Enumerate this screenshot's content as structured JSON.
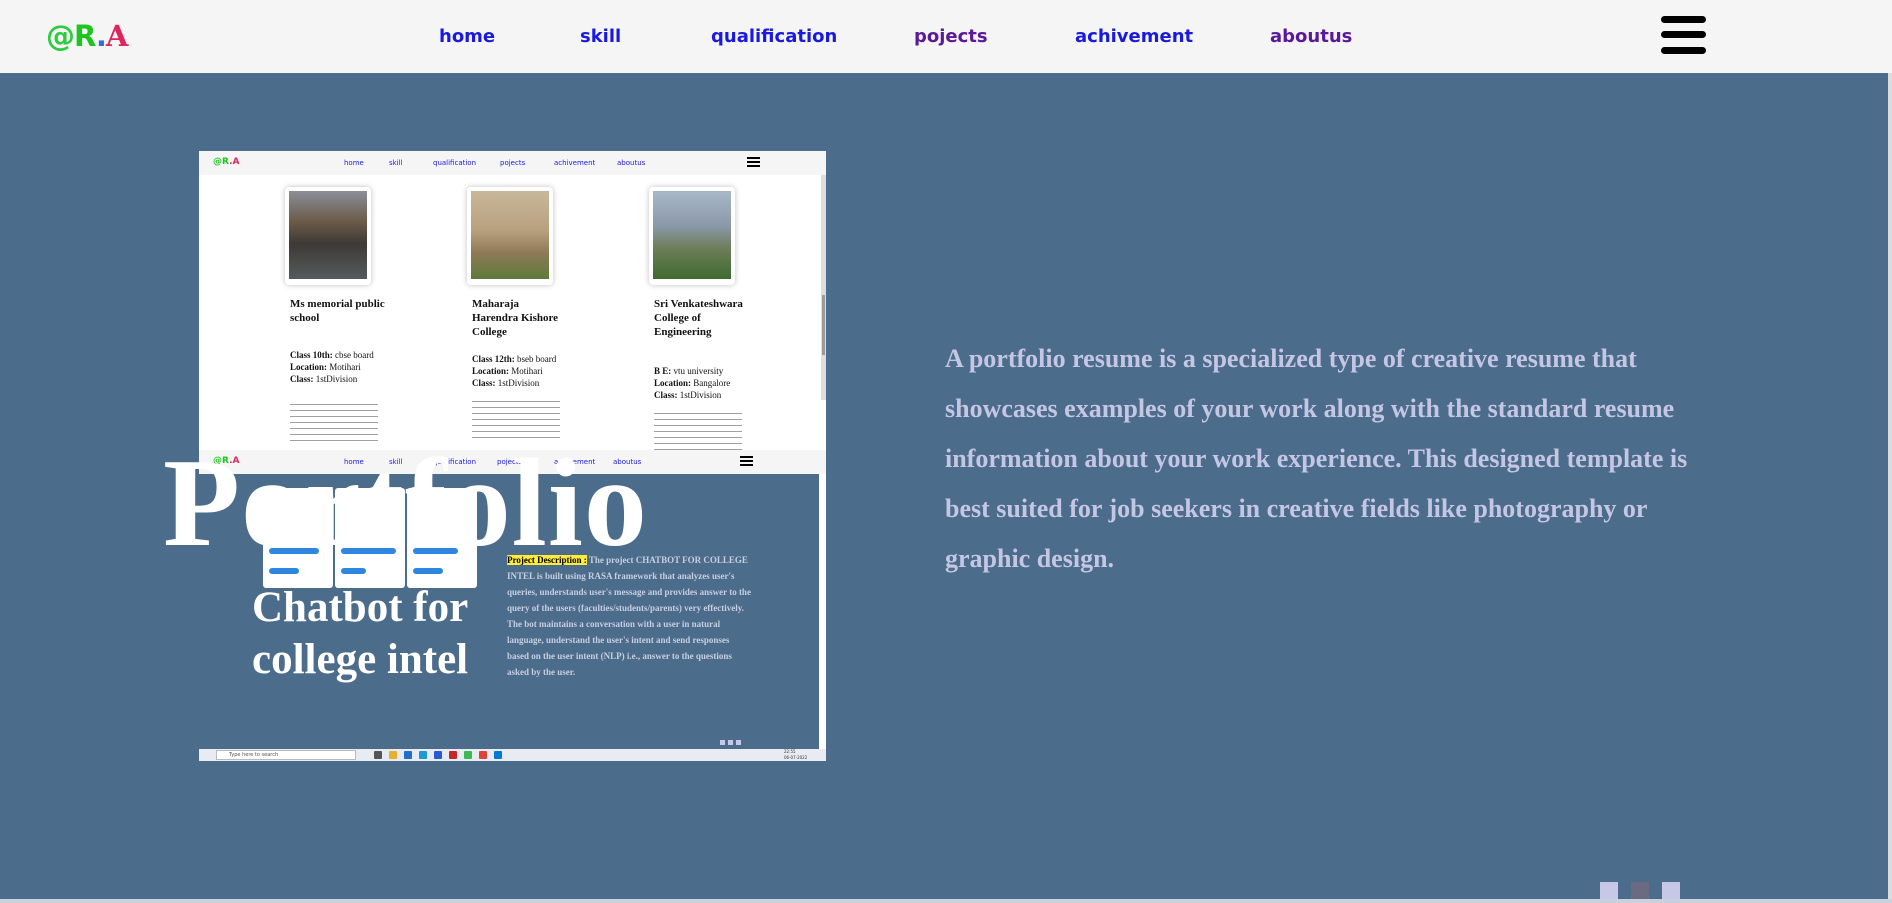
{
  "nav": {
    "logo": {
      "at": "@",
      "r": "R",
      "dot": ".",
      "a": "A"
    },
    "links": [
      "home",
      "skill",
      "qualification",
      "pojects",
      "achivement",
      "aboutus"
    ]
  },
  "screenshot": {
    "mini_logo": {
      "g": "@R",
      "rr": ".A"
    },
    "mini_links": [
      "home",
      "skill",
      "qualification",
      "pojects",
      "achivement",
      "aboutus"
    ],
    "schools": [
      {
        "name": "Ms memorial public school",
        "l1_label": "Class 10th:",
        "l1_value": " cbse board",
        "l2_label": "Location:",
        "l2_value": " Motihari",
        "l3_label": "Class:",
        "l3_value": " 1stDivision"
      },
      {
        "name": "Maharaja Harendra Kishore College",
        "l1_label": "Class 12th:",
        "l1_value": " bseb board",
        "l2_label": "Location:",
        "l2_value": " Motihari",
        "l3_label": "Class:",
        "l3_value": " 1stDivision"
      },
      {
        "name": "Sri Venkateshwara College of Engineering",
        "l1_label": "B E:",
        "l1_value": " vtu university",
        "l2_label": "Location:",
        "l2_value": " Bangalore",
        "l3_label": "Class:",
        "l3_value": " 1stDivision"
      }
    ],
    "project": {
      "label": "Project Description :",
      "text": "The project CHATBOT FOR COLLEGE INTEL is built using RASA framework that analyzes user's queries, understands user's message and provides answer to the query of the users (faculties/students/parents) very effectively. The bot maintains a conversation with a user in natural language, understand the user's intent and send responses based on the user intent (NLP) i.e., answer to the questions asked by the user."
    },
    "taskbar": {
      "search": "Type here to search",
      "time": "22:55",
      "date": "06-07-2022"
    }
  },
  "overlay": {
    "portfolio": "Portfolio",
    "chatbot": "Chatbot for college intel"
  },
  "description": "A portfolio resume is a specialized type of creative resume that showcases examples of your work along with the standard resume information about your work experience. This designed template is best suited for job seekers in creative fields like photography or graphic design.",
  "colors": {
    "background": "#4b6c8b",
    "nav_bg": "#f5f5f5",
    "link": "#1a1adf",
    "desc": "#c5c6e3"
  }
}
